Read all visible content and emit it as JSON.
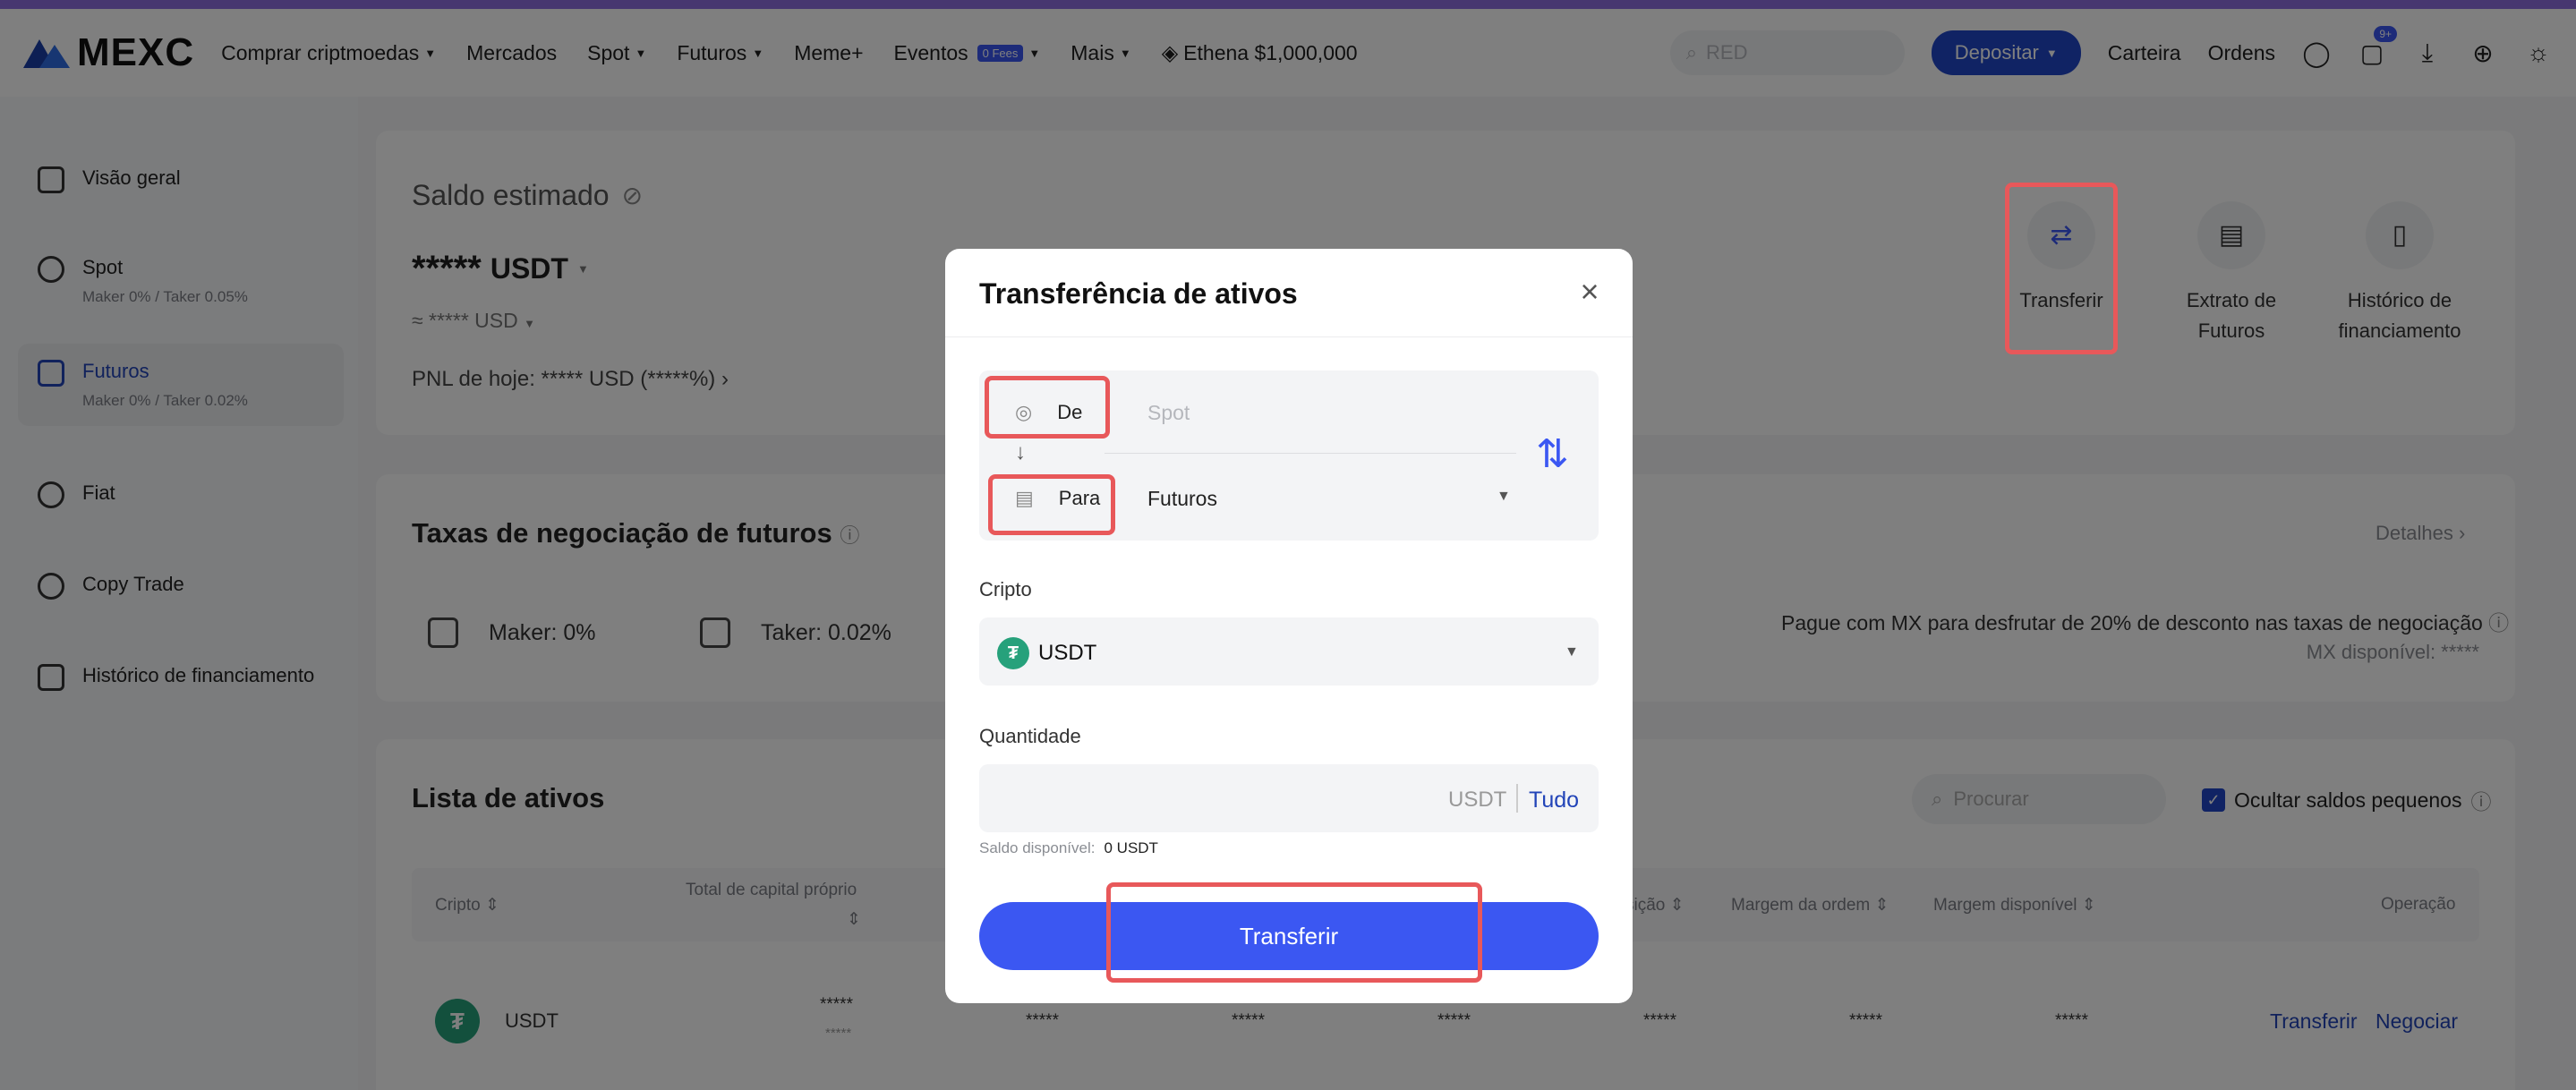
{
  "header": {
    "logo_text": "MEXC",
    "nav": {
      "buy": "Comprar criptmoedas",
      "markets": "Mercados",
      "spot": "Spot",
      "futures": "Futuros",
      "meme": "Meme+",
      "events": "Eventos",
      "events_badge": "0 Fees",
      "more": "Mais",
      "promo": "Ethena $1,000,000"
    },
    "search_placeholder": "RED",
    "deposit": "Depositar",
    "wallet": "Carteira",
    "orders": "Ordens",
    "notif_count": "9+"
  },
  "sidebar": {
    "overview": "Visão geral",
    "spot": "Spot",
    "spot_fees": "Maker 0% / Taker 0.05%",
    "futures": "Futuros",
    "futures_fees": "Maker 0% / Taker 0.02%",
    "fiat": "Fiat",
    "copy_trade": "Copy Trade",
    "funding_history": "Histórico de financiamento"
  },
  "balance": {
    "title": "Saldo estimado",
    "value": "*****",
    "currency": "USDT",
    "usd": "≈ ***** USD",
    "pnl": "PNL de hoje: ***** USD (*****%)"
  },
  "actions": {
    "transfer": "Transferir",
    "statement_1": "Extrato de",
    "statement_2": "Futuros",
    "funding_1": "Histórico de",
    "funding_2": "financiamento"
  },
  "fees": {
    "title": "Taxas de negociação de futuros",
    "maker": "Maker: 0%",
    "taker": "Taker: 0.02%",
    "details": "Detalhes",
    "mx_promo": "Pague com MX para desfrutar de 20% de desconto nas taxas de negociação",
    "mx_available": "MX disponível: *****"
  },
  "assets": {
    "title": "Lista de ativos",
    "search_placeholder": "Procurar",
    "hide_small": "Ocultar saldos pequenos",
    "columns": {
      "crypto": "Cripto",
      "equity": "Total de capital próprio",
      "position": "sição",
      "order_margin": "Margem da ordem",
      "available_margin": "Margem disponível",
      "operation": "Operação"
    },
    "row": {
      "coin": "USDT",
      "equity_top": "*****",
      "equity_bottom": "*****",
      "c1": "*****",
      "c2": "*****",
      "c3": "*****",
      "c4": "*****",
      "c5": "*****",
      "c6": "*****",
      "transfer": "Transferir",
      "trade": "Negociar"
    }
  },
  "modal": {
    "title": "Transferência de ativos",
    "from_label": "De",
    "from_value": "Spot",
    "to_label": "Para",
    "to_value": "Futuros",
    "crypto_label": "Cripto",
    "crypto_value": "USDT",
    "amount_label": "Quantidade",
    "amount_unit": "USDT",
    "all": "Tudo",
    "available_label": "Saldo disponível:",
    "available_value": "0 USDT",
    "submit": "Transferir"
  },
  "colors": {
    "brand_blue": "#2147c8",
    "primary_button": "#3b57f2",
    "annotation_red": "#e8585a",
    "usdt_green": "#26a17b"
  }
}
